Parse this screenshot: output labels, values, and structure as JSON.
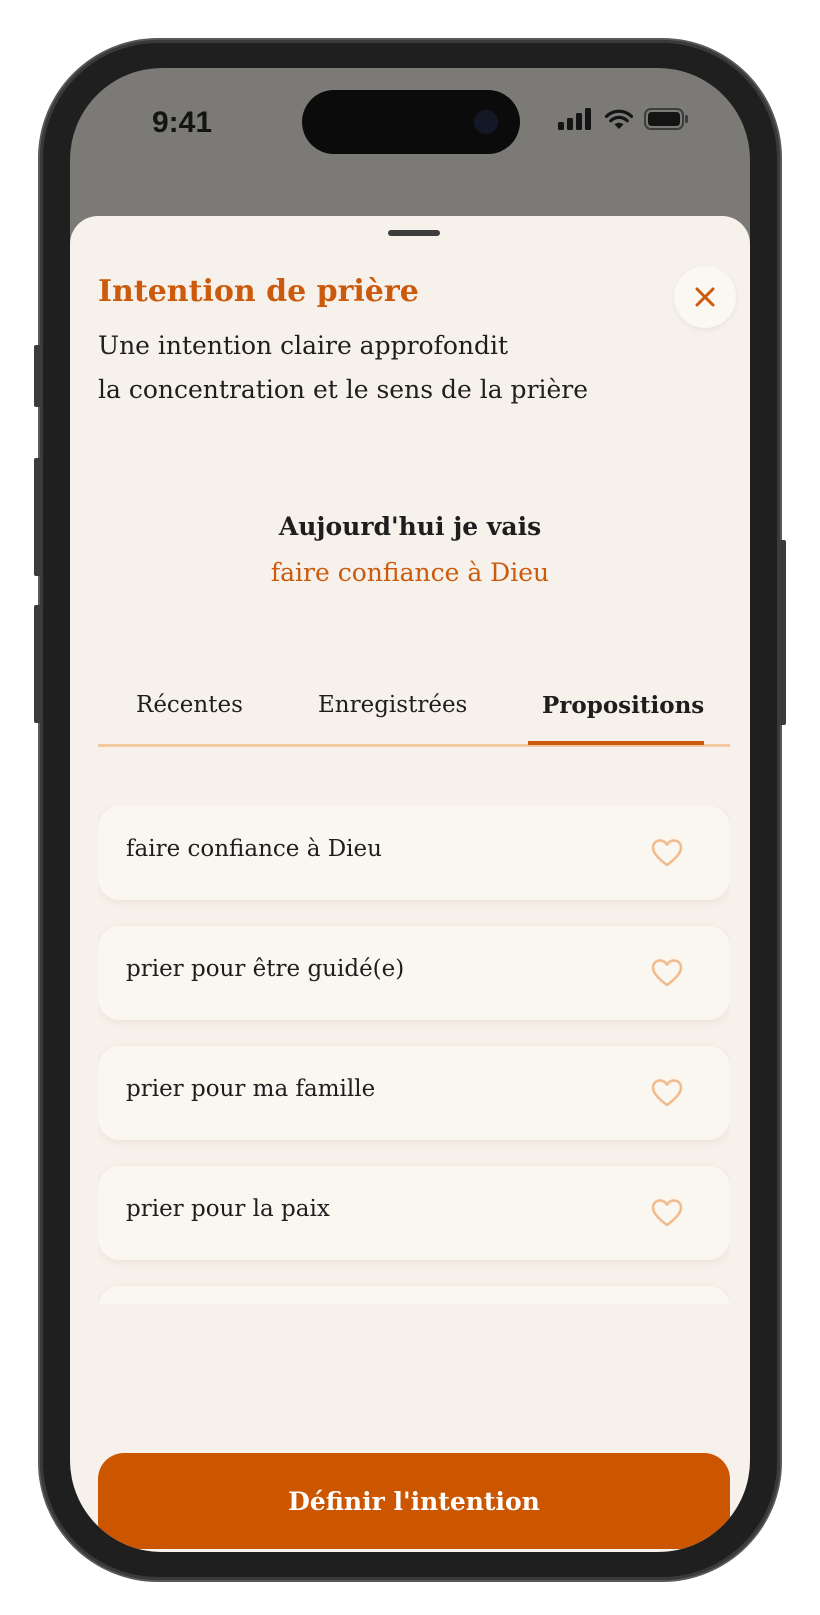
{
  "status_bar": {
    "time": "9:41"
  },
  "sheet": {
    "title": "Intention de prière",
    "subtitle_lines": [
      "Une intention claire approfondit",
      "la concentration et le sens de la prière"
    ],
    "today_label": "Aujourd'hui je vais",
    "today_value": "faire confiance à Dieu"
  },
  "tabs": [
    {
      "label": "Récentes",
      "active": false
    },
    {
      "label": "Enregistrées",
      "active": false
    },
    {
      "label": "Propositions",
      "active": true
    }
  ],
  "suggestions": [
    {
      "label": "faire confiance à Dieu",
      "favorite": false
    },
    {
      "label": "prier pour être guidé(e)",
      "favorite": false
    },
    {
      "label": "prier pour ma famille",
      "favorite": false
    },
    {
      "label": "prier pour la paix",
      "favorite": false
    }
  ],
  "primary_button": {
    "label": "Définir l'intention"
  },
  "colors": {
    "accent": "#cc5a0c",
    "button": "#cc5600",
    "sheet_background": "#f6f1ea",
    "tab_track": "#f3c9a1",
    "heart": "#f2b98a"
  },
  "icons": {
    "close": "close-icon",
    "favorite": "heart-outline-icon",
    "signal": "cellular-signal-icon",
    "wifi": "wifi-icon",
    "battery": "battery-icon"
  }
}
